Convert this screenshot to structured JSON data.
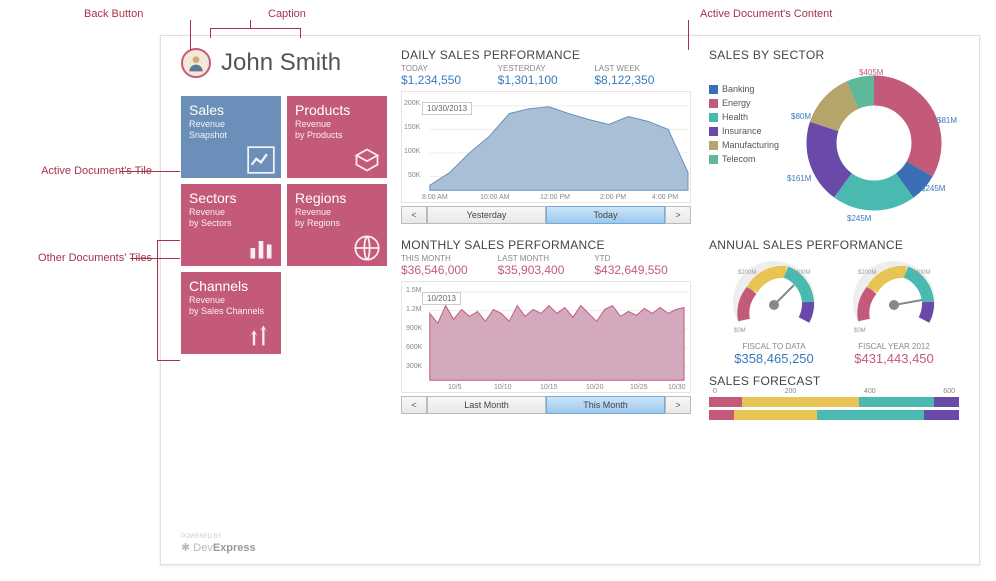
{
  "annotations": {
    "back_button": "Back Button",
    "caption": "Caption",
    "active_content": "Active Document's Content",
    "active_tile": "Active Document's Tile",
    "other_tiles": "Other Documents' Tiles"
  },
  "header": {
    "user_name": "John Smith"
  },
  "tiles": {
    "sales": {
      "title": "Sales",
      "sub1": "Revenue",
      "sub2": "Snapshot"
    },
    "products": {
      "title": "Products",
      "sub1": "Revenue",
      "sub2": "by Products"
    },
    "sectors": {
      "title": "Sectors",
      "sub1": "Revenue",
      "sub2": "by Sectors"
    },
    "regions": {
      "title": "Regions",
      "sub1": "Revenue",
      "sub2": "by Regions"
    },
    "channels": {
      "title": "Channels",
      "sub1": "Revenue",
      "sub2": "by Sales Channels"
    }
  },
  "daily": {
    "title": "DAILY SALES PERFORMANCE",
    "today_label": "TODAY",
    "today_val": "$1,234,550",
    "yesterday_label": "YESTERDAY",
    "yesterday_val": "$1,301,100",
    "lastweek_label": "LAST WEEK",
    "lastweek_val": "$8,122,350",
    "tooltip": "10/30/2013",
    "pager_prev": "<",
    "pager_yesterday": "Yesterday",
    "pager_today": "Today",
    "pager_next": ">"
  },
  "monthly": {
    "title": "MONTHLY SALES PERFORMANCE",
    "thismonth_label": "THIS MONTH",
    "thismonth_val": "$36,546,000",
    "lastmonth_label": "LAST MONTH",
    "lastmonth_val": "$35,903,400",
    "ytd_label": "YTD",
    "ytd_val": "$432,649,550",
    "tooltip": "10/2013",
    "pager_prev": "<",
    "pager_last": "Last Month",
    "pager_this": "This Month",
    "pager_next": ">"
  },
  "sector": {
    "title": "SALES BY SECTOR",
    "legend": [
      "Banking",
      "Energy",
      "Health",
      "Insurance",
      "Manufacturing",
      "Telecom"
    ],
    "labels": {
      "banking": "$81M",
      "energy": "$405M",
      "health": "$245M",
      "insurance": "$245M",
      "manufacturing": "$161M",
      "telecom": "$80M"
    }
  },
  "annual": {
    "title": "ANNUAL SALES PERFORMANCE",
    "fiscal_data_label": "FISCAL TO DATA",
    "fiscal_data_val": "$358,465,250",
    "fiscal_2012_label": "FISCAL YEAR 2012",
    "fiscal_2012_val": "$431,443,450",
    "gauge_ticks": {
      "min": "$0M",
      "mid_l": "$200M",
      "mid_r": "$400M",
      "max": "$400M"
    }
  },
  "forecast": {
    "title": "SALES FORECAST",
    "ticks": [
      "0",
      "200",
      "400",
      "600"
    ]
  },
  "logo": {
    "powered": "POWERED BY",
    "brand_a": "Dev",
    "brand_b": "Express"
  },
  "colors": {
    "banking": "#3a6fb5",
    "energy": "#c45a7a",
    "health": "#4ab9b0",
    "insurance": "#6a4aa8",
    "manufacturing": "#b5a56a",
    "telecom": "#5fb89a",
    "blue_tile": "#6b8fb8",
    "pink_tile": "#c45a7a",
    "area_blue": "#a8bfd6",
    "area_pink": "#d4a8bd",
    "gauge_yellow": "#e8c454"
  },
  "chart_data": [
    {
      "type": "area",
      "name": "daily_sales",
      "x_ticks": [
        "8:00 AM",
        "10:00 AM",
        "12:00 PM",
        "2:00 PM",
        "4:00 PM"
      ],
      "y_ticks": [
        "50K",
        "100K",
        "150K",
        "200K"
      ],
      "ylim": [
        0,
        200000
      ],
      "values": [
        30000,
        55000,
        95000,
        130000,
        175000,
        185000,
        190000,
        175000,
        165000,
        155000,
        170000,
        165000,
        150000,
        55000
      ]
    },
    {
      "type": "area",
      "name": "monthly_sales",
      "x_ticks": [
        "10/5",
        "10/10",
        "10/15",
        "10/20",
        "10/25",
        "10/30"
      ],
      "y_ticks": [
        "300K",
        "600K",
        "900K",
        "1.2M",
        "1.5M"
      ],
      "ylim": [
        0,
        1500000
      ],
      "values": [
        1150000,
        1000000,
        1300000,
        1100000,
        1250000,
        1150000,
        1200000,
        1100000,
        1250000,
        1200000,
        1100000,
        1300000,
        1150000,
        1250000,
        1200000,
        1300000,
        1200000,
        1280000,
        1150000,
        1300000,
        1200000,
        1100000,
        1250000,
        1300000,
        1150000,
        1220000,
        1180000,
        1260000,
        1200000,
        1280000
      ]
    },
    {
      "type": "pie",
      "name": "sales_by_sector",
      "series": [
        {
          "name": "Banking",
          "value": 81,
          "color": "#3a6fb5"
        },
        {
          "name": "Energy",
          "value": 405,
          "color": "#c45a7a"
        },
        {
          "name": "Health",
          "value": 245,
          "color": "#4ab9b0"
        },
        {
          "name": "Insurance",
          "value": 245,
          "color": "#6a4aa8"
        },
        {
          "name": "Manufacturing",
          "value": 161,
          "color": "#b5a56a"
        },
        {
          "name": "Telecom",
          "value": 80,
          "color": "#5fb89a"
        }
      ],
      "unit": "$M"
    },
    {
      "type": "bar",
      "name": "sales_forecast",
      "xlim": [
        0,
        600
      ],
      "series": [
        {
          "name": "a",
          "values": [
            80,
            280,
            180,
            60
          ],
          "colors": [
            "#c45a7a",
            "#e8c454",
            "#4ab9b0",
            "#6a4aa8"
          ]
        },
        {
          "name": "b",
          "values": [
            60,
            200,
            260,
            80
          ],
          "colors": [
            "#c45a7a",
            "#e8c454",
            "#4ab9b0",
            "#6a4aa8"
          ]
        }
      ]
    }
  ]
}
